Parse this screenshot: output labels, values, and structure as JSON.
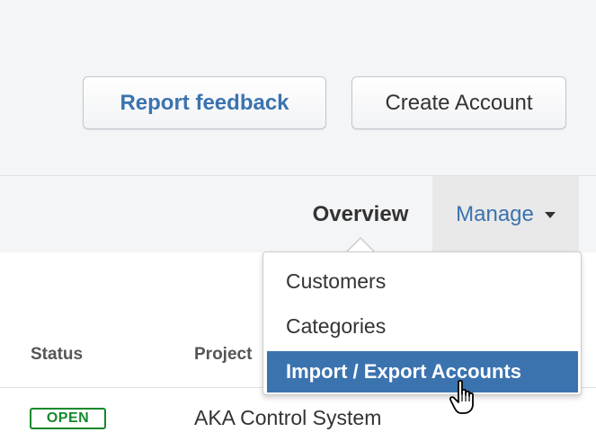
{
  "header": {
    "report_feedback_label": "Report feedback",
    "create_account_label": "Create Account"
  },
  "tabs": {
    "overview_label": "Overview",
    "manage_label": "Manage"
  },
  "manage_menu": {
    "items": [
      {
        "label": "Customers",
        "highlighted": false
      },
      {
        "label": "Categories",
        "highlighted": false
      },
      {
        "label": "Import / Export Accounts",
        "highlighted": true
      }
    ]
  },
  "table": {
    "columns": [
      "Status",
      "Project"
    ],
    "rows": [
      {
        "status": "OPEN",
        "project": "AKA Control System"
      }
    ]
  },
  "colors": {
    "link_blue": "#3b73af",
    "open_green": "#14892c",
    "header_bg": "#f4f5f7",
    "menu_highlight": "#3b73af"
  },
  "icons": {
    "manage_caret": "caret-down-icon",
    "pointer": "hand-pointer-cursor-icon"
  }
}
